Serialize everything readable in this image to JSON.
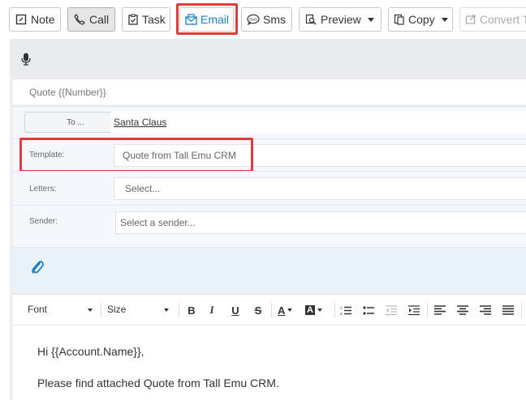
{
  "toolbar": {
    "note": "Note",
    "call": "Call",
    "task": "Task",
    "email": "Email",
    "sms": "Sms",
    "sms_icon_text": "SMS",
    "preview": "Preview",
    "copy": "Copy",
    "convert": "Convert T"
  },
  "compose": {
    "subject": "Quote {{Number}}",
    "to_button": "To ...",
    "to_value": "Santa Claus",
    "template_label": "Template:",
    "template_value": "Quote from Tall Emu CRM",
    "letters_label": "Letters:",
    "letters_placeholder": "Select...",
    "sender_label": "Sender:",
    "sender_placeholder": "Select a sender..."
  },
  "editor": {
    "font": "Font",
    "size": "Size",
    "bold": "B",
    "italic": "I",
    "underline": "U",
    "strike": "S",
    "text_color": "A",
    "bg_color": "A",
    "body_line1": "Hi {{Account.Name}},",
    "body_line2": "Please find attached Quote from Tall Emu CRM."
  },
  "colors": {
    "accent": "#1a7fc4",
    "highlight": "#e03c3c"
  }
}
